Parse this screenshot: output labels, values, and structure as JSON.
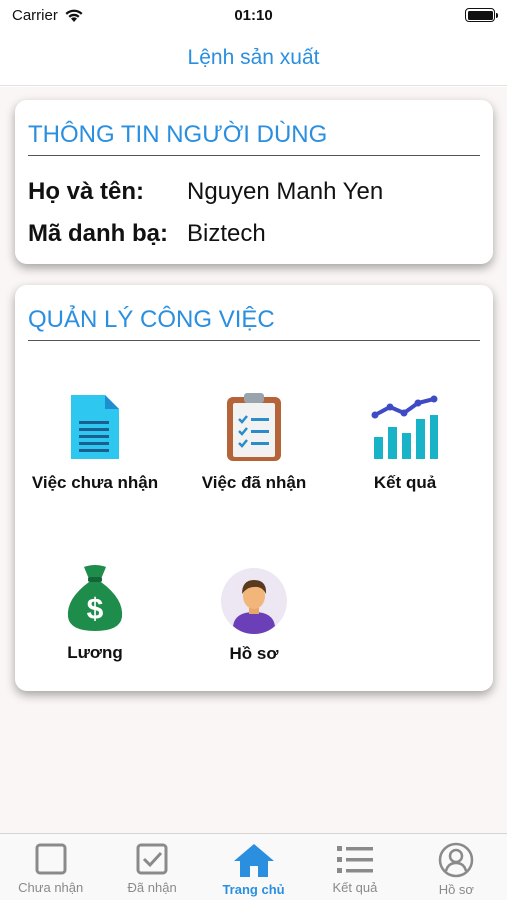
{
  "status_bar": {
    "carrier": "Carrier",
    "time": "01:10"
  },
  "nav": {
    "title": "Lệnh sản xuất"
  },
  "user_info": {
    "header": "THÔNG TIN NGƯỜI DÙNG",
    "name_label": "Họ và tên:",
    "name_value": "Nguyen Manh Yen",
    "directory_label": "Mã danh bạ:",
    "directory_value": "Biztech"
  },
  "work": {
    "header": "QUẢN LÝ CÔNG VIỆC",
    "tiles": [
      {
        "label": "Việc chưa nhận",
        "icon": "document-icon"
      },
      {
        "label": "Việc đã nhận",
        "icon": "clipboard-check-icon"
      },
      {
        "label": "Kết quả",
        "icon": "bar-chart-icon"
      },
      {
        "label": "Lương",
        "icon": "money-bag-icon"
      },
      {
        "label": "Hồ sơ",
        "icon": "user-avatar-icon"
      }
    ]
  },
  "tab_bar": {
    "items": [
      {
        "label": "Chưa nhận",
        "icon": "square-icon",
        "active": false
      },
      {
        "label": "Đã nhận",
        "icon": "checkbox-icon",
        "active": false
      },
      {
        "label": "Trang chủ",
        "icon": "home-icon",
        "active": true
      },
      {
        "label": "Kết quả",
        "icon": "list-icon",
        "active": false
      },
      {
        "label": "Hồ sơ",
        "icon": "profile-circle-icon",
        "active": false
      }
    ]
  },
  "colors": {
    "accent": "#2b8fe0",
    "inactive": "#8a8a8a"
  }
}
